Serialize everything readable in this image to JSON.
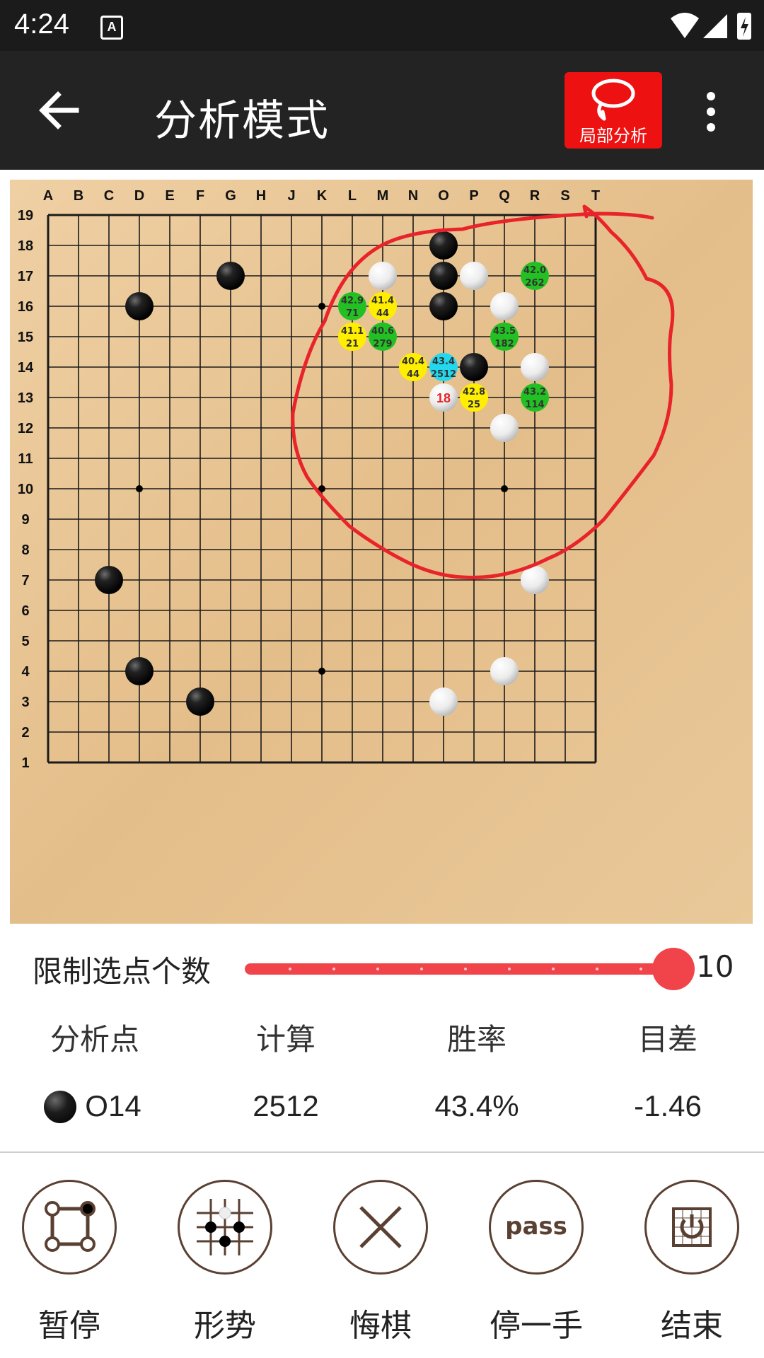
{
  "status_bar": {
    "time": "4:24",
    "notif_letter": "A"
  },
  "app_bar": {
    "title": "分析模式",
    "local_analysis_label": "局部分析"
  },
  "board": {
    "col_labels": [
      "A",
      "B",
      "C",
      "D",
      "E",
      "F",
      "G",
      "H",
      "J",
      "K",
      "L",
      "M",
      "N",
      "O",
      "P",
      "Q",
      "R",
      "S",
      "T"
    ],
    "row_labels": [
      "19",
      "18",
      "17",
      "16",
      "15",
      "14",
      "13",
      "12",
      "11",
      "10",
      "9",
      "8",
      "7",
      "6",
      "5",
      "4",
      "3",
      "2",
      "1"
    ],
    "black_stones": [
      "O18",
      "G17",
      "O17",
      "D16",
      "O16",
      "P14",
      "C7",
      "D4",
      "F3"
    ],
    "white_stones": [
      "M17",
      "P17",
      "Q16",
      "R14",
      "Q12",
      "R7",
      "Q4",
      "O3"
    ],
    "last_move": {
      "point": "O13",
      "number": "18"
    },
    "candidates": [
      {
        "point": "R17",
        "winrate": "42.0",
        "visits": "262",
        "color": "green"
      },
      {
        "point": "L16",
        "winrate": "42.9",
        "visits": "71",
        "color": "green"
      },
      {
        "point": "M16",
        "winrate": "41.4",
        "visits": "44",
        "color": "yellow"
      },
      {
        "point": "L15",
        "winrate": "41.1",
        "visits": "21",
        "color": "yellow"
      },
      {
        "point": "M15",
        "winrate": "40.6",
        "visits": "279",
        "color": "green"
      },
      {
        "point": "Q15",
        "winrate": "43.5",
        "visits": "182",
        "color": "green"
      },
      {
        "point": "N14",
        "winrate": "40.4",
        "visits": "44",
        "color": "yellow"
      },
      {
        "point": "O14",
        "winrate": "43.4",
        "visits": "2512",
        "color": "cyan"
      },
      {
        "point": "P13",
        "winrate": "42.8",
        "visits": "25",
        "color": "yellow"
      },
      {
        "point": "R13",
        "winrate": "43.2",
        "visits": "114",
        "color": "green"
      }
    ],
    "colors": {
      "green": "#22c022",
      "yellow": "#ffee00",
      "cyan": "#22d8ee",
      "wood": "#e8c594",
      "line": "#1a1a1a",
      "circle": "#e8232a"
    }
  },
  "slider": {
    "label": "限制选点个数",
    "value": "10",
    "fraction": 1.0,
    "tick_count": 9
  },
  "analysis_table": {
    "headers": [
      "分析点",
      "计算",
      "胜率",
      "目差"
    ],
    "row": {
      "point": "O14",
      "visits": "2512",
      "winrate": "43.4%",
      "score": "-1.46"
    }
  },
  "toolbar": [
    {
      "label": "暂停",
      "icon": "region-select-icon"
    },
    {
      "label": "形势",
      "icon": "territory-icon"
    },
    {
      "label": "悔棋",
      "icon": "undo-x-icon"
    },
    {
      "label": "停一手",
      "icon": "pass-icon"
    },
    {
      "label": "结束",
      "icon": "power-icon"
    }
  ]
}
